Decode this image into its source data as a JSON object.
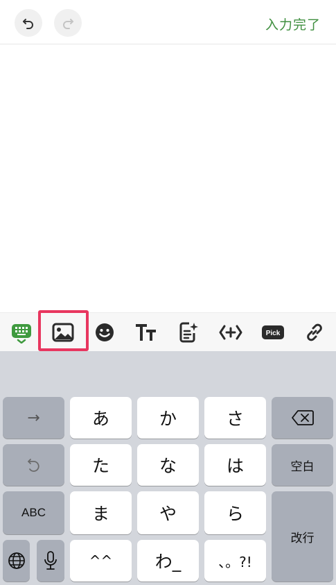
{
  "topbar": {
    "undo_icon": "undo-icon",
    "redo_icon": "redo-icon",
    "done_label": "入力完了"
  },
  "toolbar": {
    "items": [
      {
        "icon": "keyboard-icon"
      },
      {
        "icon": "image-icon"
      },
      {
        "icon": "emoji-icon"
      },
      {
        "icon": "text-style-icon"
      },
      {
        "icon": "ai-note-icon"
      },
      {
        "icon": "code-icon"
      },
      {
        "icon": "pick-icon",
        "label": "Pick"
      },
      {
        "icon": "link-icon"
      }
    ]
  },
  "keyboard": {
    "arrow_key": "→",
    "undo_key_icon": "undo-icon",
    "abc_key": "ABC",
    "globe_icon": "globe-icon",
    "mic_icon": "mic-icon",
    "keys": [
      "あ",
      "か",
      "さ",
      "た",
      "な",
      "は",
      "ま",
      "や",
      "ら",
      "^^",
      "わ_",
      "、。?!"
    ],
    "backspace_icon": "backspace-icon",
    "space_key": "空白",
    "enter_key": "改行"
  },
  "colors": {
    "accent_green": "#3f8f3f",
    "highlight": "#e8365f",
    "keyboard_bg": "#d3d6dc",
    "dark_key": "#a9aeb8"
  }
}
